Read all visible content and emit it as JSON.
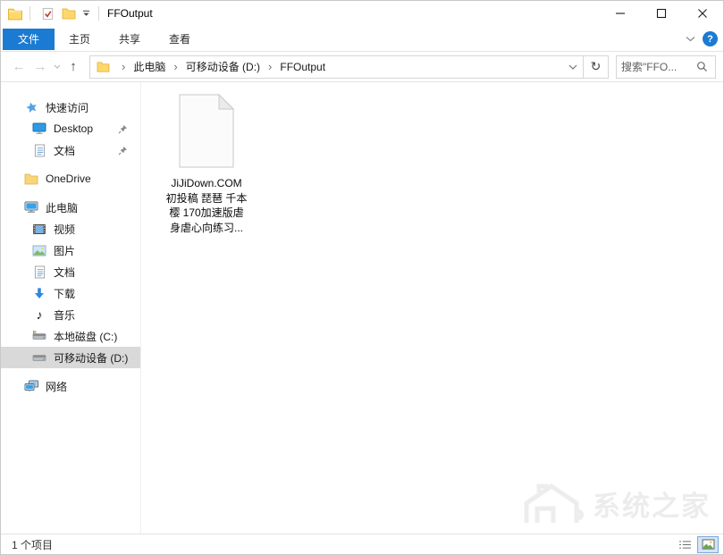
{
  "titlebar": {
    "title": "FFOutput"
  },
  "ribbon": {
    "tabs": [
      "文件",
      "主页",
      "共享",
      "查看"
    ],
    "selected_tab": "文件"
  },
  "address_bar": {
    "breadcrumb": [
      "此电脑",
      "可移动设备 (D:)",
      "FFOutput"
    ],
    "search_placeholder": "搜索\"FFO..."
  },
  "glyphs": {
    "back": "←",
    "forward": "→",
    "up": "↑",
    "refresh": "↻",
    "crumb_separator": "›",
    "music_note": "♪",
    "help": "?"
  },
  "sidebar": {
    "items": [
      {
        "label": "快速访问",
        "icon": "quick-access-star"
      },
      {
        "label": "Desktop",
        "icon": "desktop-monitor",
        "pinned": true
      },
      {
        "label": "文档",
        "icon": "document",
        "pinned": true
      },
      {
        "label": "OneDrive",
        "icon": "onedrive-folder"
      },
      {
        "label": "此电脑",
        "icon": "this-pc"
      },
      {
        "label": "视频",
        "icon": "videos"
      },
      {
        "label": "图片",
        "icon": "pictures"
      },
      {
        "label": "文档",
        "icon": "document"
      },
      {
        "label": "下载",
        "icon": "downloads"
      },
      {
        "label": "音乐",
        "icon": "music"
      },
      {
        "label": "本地磁盘 (C:)",
        "icon": "drive-windows"
      },
      {
        "label": "可移动设备 (D:)",
        "icon": "drive",
        "selected": true
      },
      {
        "label": "网络",
        "icon": "network"
      }
    ]
  },
  "content": {
    "files": [
      {
        "name": "JiJiDown.COM 初投稿 琵琶 千本樱 170加速版虐身虐心向练习...",
        "lines": [
          "JiJiDown.COM",
          "初投稿 琵琶 千本",
          "樱 170加速版虐",
          "身虐心向练习..."
        ]
      }
    ]
  },
  "status_bar": {
    "item_count": "1 个项目"
  },
  "watermark": {
    "text": "系统之家"
  },
  "colors": {
    "accent_blue": "#1b7bd2",
    "selected_item_gray": "#d9d9d9",
    "folder_yellow": "#ffd86b"
  }
}
